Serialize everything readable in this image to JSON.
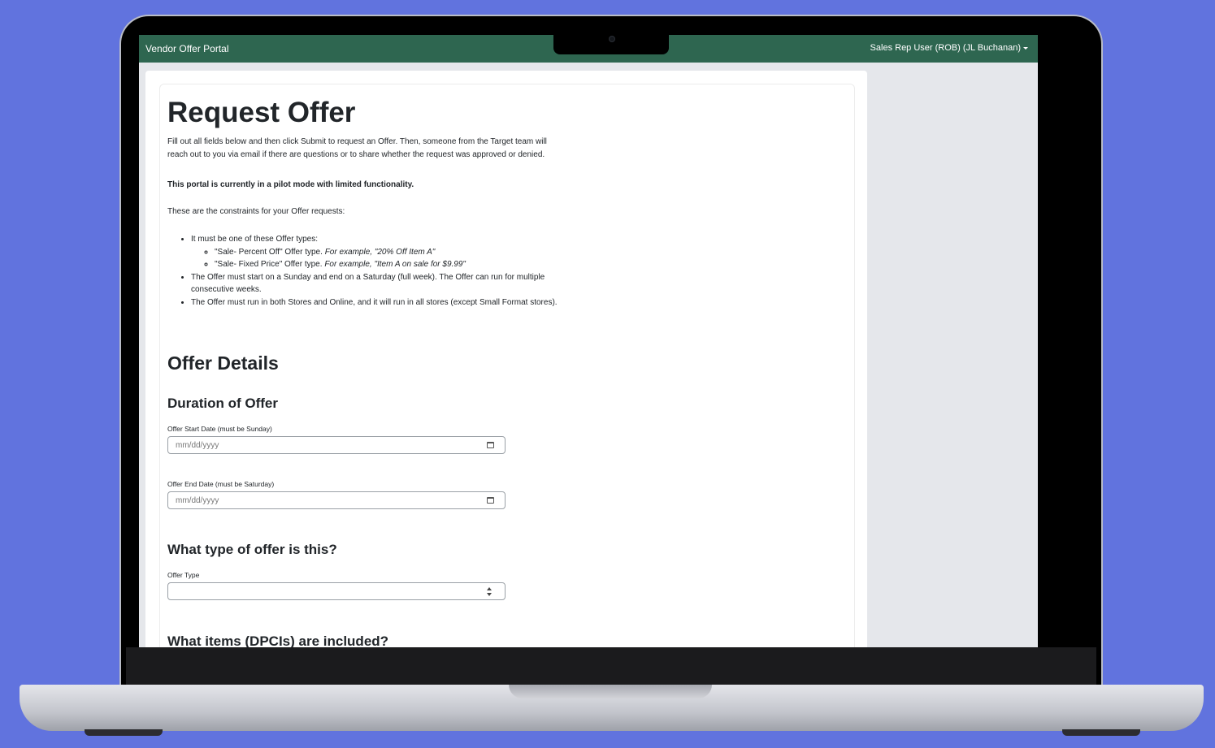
{
  "app": {
    "brand": "Vendor Offer Portal",
    "user_menu": "Sales Rep User (ROB) (JL Buchanan)"
  },
  "page": {
    "title": "Request Offer",
    "intro": "Fill out all fields below and then click Submit to request an Offer. Then, someone from the Target team will reach out to you via email if there are questions or to share whether the request was approved or denied.",
    "pilot_notice": "This portal is currently in a pilot mode with limited functionality.",
    "constraints_intro": "These are the constraints for your Offer requests:",
    "rules": {
      "types_intro": "It must be one of these Offer types:",
      "type1": "\"Sale- Percent Off\" Offer type.",
      "type1_example": "For example, \"20% Off Item A\"",
      "type2": "\"Sale- Fixed Price\" Offer type.",
      "type2_example": "For example, \"Item A on sale for $9.99\"",
      "rule2": "The Offer must start on a Sunday and end on a Saturday (full week). The Offer can run for multiple consecutive weeks.",
      "rule3": "The Offer must run in both Stores and Online, and it will run in all stores (except Small Format stores)."
    }
  },
  "offer_details": {
    "heading": "Offer Details",
    "duration_heading": "Duration of Offer",
    "start_label": "Offer Start Date (must be Sunday)",
    "start_placeholder": "mm/dd/yyyy",
    "end_label": "Offer End Date (must be Saturday)",
    "end_placeholder": "mm/dd/yyyy",
    "type_heading": "What type of offer is this?",
    "type_label": "Offer Type",
    "type_value": "",
    "items_heading": "What items (DPCIs) are included?"
  },
  "colors": {
    "navbar": "#2e6650",
    "background": "#6173de"
  }
}
